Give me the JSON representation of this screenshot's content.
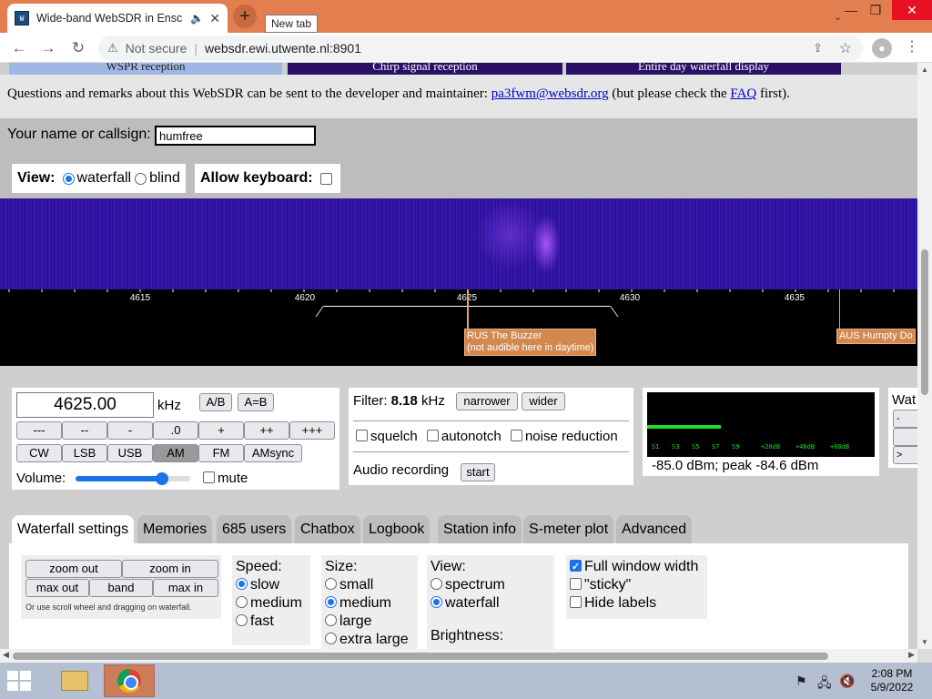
{
  "browser": {
    "tab_title": "Wide-band WebSDR in Ensc",
    "new_tab_tooltip": "New tab",
    "security_label": "Not secure",
    "url": "websdr.ewi.utwente.nl:8901",
    "favicon_text": "W"
  },
  "page": {
    "banners": [
      "WSPR reception",
      "Chirp signal reception",
      "Entire day waterfall display"
    ],
    "remark_prefix": "Questions and remarks about this WebSDR can be sent to the developer and maintainer: ",
    "remark_email": "pa3fwm@websdr.org",
    "remark_middle": " (but please check the ",
    "remark_faq": "FAQ",
    "remark_suffix": " first).",
    "callsign_label": "Your name or callsign:",
    "callsign_value": "humfree",
    "view_label": "View:",
    "view_waterfall": "waterfall",
    "view_blind": "blind",
    "keyboard_label": "Allow keyboard:"
  },
  "scale": {
    "ticks": [
      "4615",
      "4620",
      "4625",
      "4630",
      "4635"
    ],
    "station1_line1": "RUS The Buzzer",
    "station1_line2": "(not audible here in daytime)",
    "station2": "AUS Humpty Do"
  },
  "tuning": {
    "frequency": "4625.00",
    "unit": "kHz",
    "ab": "A/B",
    "aeqb": "A=B",
    "steps": [
      "---",
      "--",
      "-",
      ".0",
      "+",
      "++",
      "+++"
    ],
    "modes": [
      "CW",
      "LSB",
      "USB",
      "AM",
      "FM",
      "AMsync"
    ],
    "selected_mode": "AM",
    "volume_label": "Volume:",
    "volume_level": 0.75,
    "mute_label": "mute"
  },
  "filter": {
    "label": "Filter:",
    "bandwidth": "8.18",
    "unit": "kHz",
    "narrower": "narrower",
    "wider": "wider",
    "squelch": "squelch",
    "autonotch": "autonotch",
    "noise_reduction": "noise reduction",
    "recording_label": "Audio recording",
    "start": "start"
  },
  "smeter": {
    "scale": [
      "S1",
      "S3",
      "S5",
      "S7",
      "S9",
      "+20dB",
      "+40dB",
      "+60dB"
    ],
    "reading": "-85.0 dBm; peak  -84.6 dBm",
    "color": "#22dd22"
  },
  "wbox": {
    "title": "Wat",
    "buttons": [
      "-",
      "",
      ">"
    ]
  },
  "tabs": [
    "Waterfall settings",
    "Memories",
    "685 users",
    "Chatbox",
    "Logbook",
    "Station info",
    "S-meter plot",
    "Advanced"
  ],
  "panel": {
    "zoom_out": "zoom out",
    "zoom_in": "zoom in",
    "max_out": "max out",
    "band": "band",
    "max_in": "max in",
    "zoom_note": "Or use scroll wheel and dragging on waterfall.",
    "speed_label": "Speed:",
    "speed_opts": [
      "slow",
      "medium",
      "fast"
    ],
    "size_label": "Size:",
    "size_opts": [
      "small",
      "medium",
      "large",
      "extra large"
    ],
    "view_label": "View:",
    "view_opts": [
      "spectrum",
      "waterfall"
    ],
    "brightness_label": "Brightness:",
    "full_width": "Full window width",
    "sticky": "\"sticky\"",
    "hide_labels": "Hide labels"
  },
  "taskbar": {
    "time": "2:08 PM",
    "date": "5/9/2022"
  }
}
